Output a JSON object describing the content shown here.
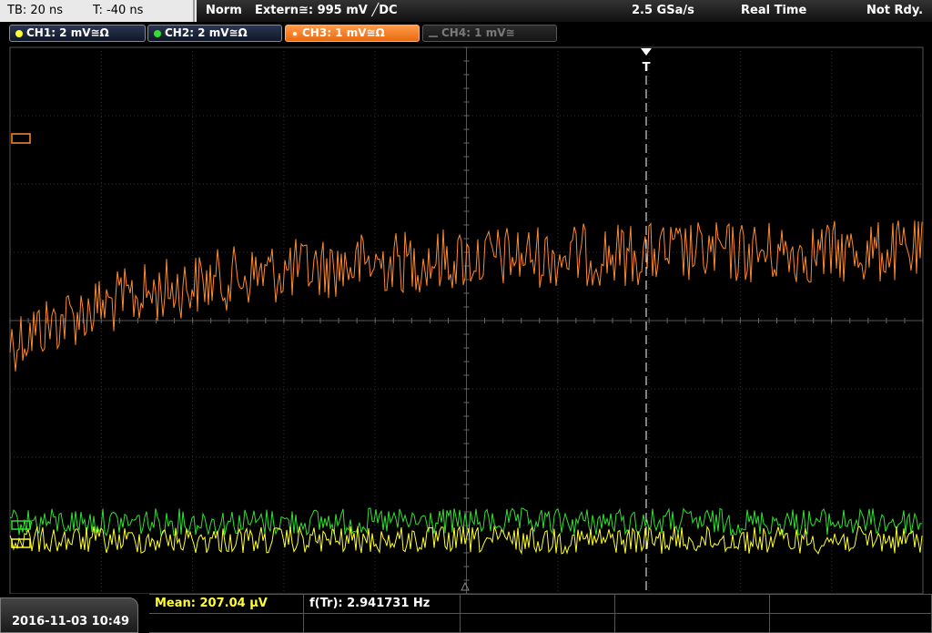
{
  "top": {
    "tb": "TB: 20 ns",
    "t": "T: -40 ns",
    "mode": "Norm",
    "trigger": "Extern≅: 995 mV ╱DC",
    "rate": "2.5 GSa/s",
    "acq": "Real Time",
    "status": "Not Rdy."
  },
  "channels": [
    {
      "label": "CH1: 2 mV≅Ω",
      "dot": "#ffff30",
      "state": "on"
    },
    {
      "label": "CH2: 2 mV≅Ω",
      "dot": "#30e030",
      "state": "on"
    },
    {
      "label": "CH3: 1 mV≅Ω",
      "dot": "#ff8a30",
      "state": "selected"
    },
    {
      "label": "CH4: 1 mV≅",
      "dot": "#666666",
      "state": "off"
    }
  ],
  "markers": {
    "trigger": "T"
  },
  "measurements": {
    "mean": "Mean: 207.04 µV",
    "freq": "f(Tr): 2.941731 Hz"
  },
  "datetime": "2016-11-03 10:49",
  "colors": {
    "ch1": "#ffff30",
    "ch2": "#30e030",
    "ch3": "#ff8a30",
    "grid": "#3a3a3a"
  }
}
